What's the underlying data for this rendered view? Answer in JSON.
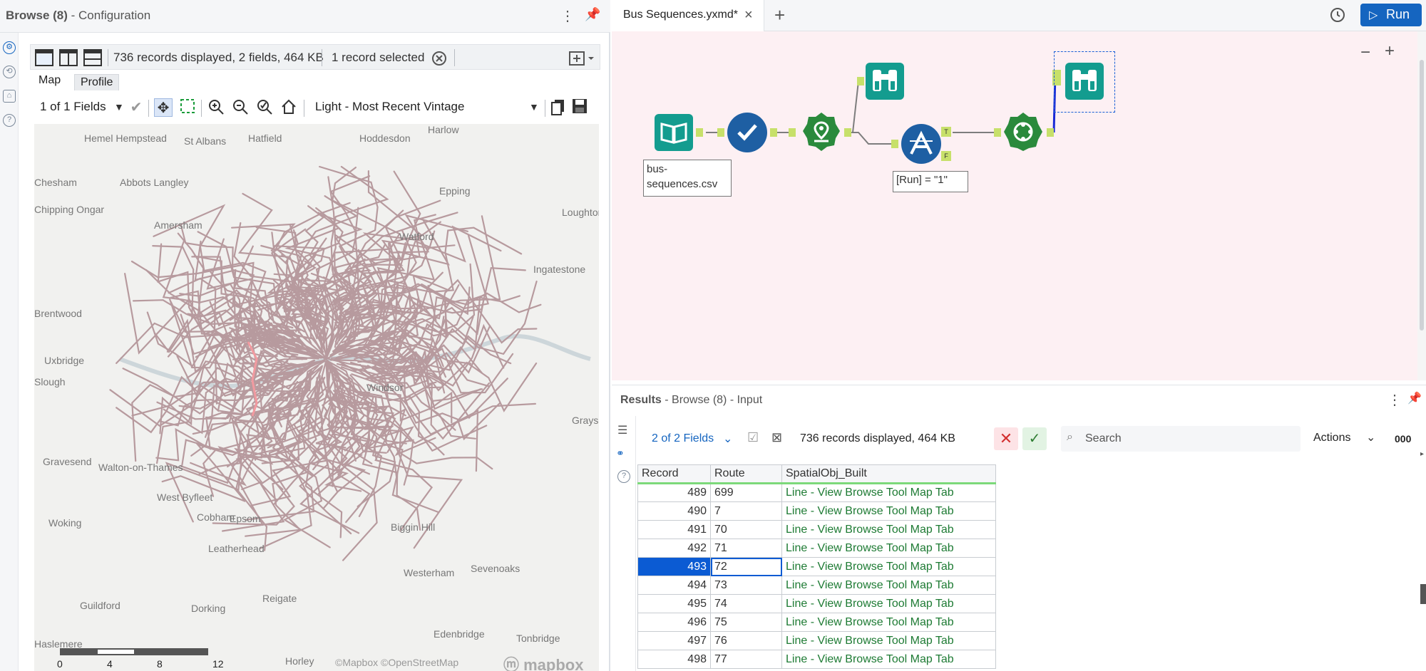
{
  "left_panel": {
    "title_prefix": "Browse (8)",
    "title_suffix": " - Configuration",
    "toolbar": {
      "records_info": "736 records displayed, 2 fields, 464 KB",
      "selected_info": "1 record selected"
    },
    "tabs": {
      "map": "Map",
      "profile": "Profile"
    },
    "fields_select": "1 of 1 Fields",
    "basemap_select": "Light - Most Recent Vintage",
    "map": {
      "places": [
        "Hemel Hempstead",
        "St Albans",
        "Hatfield",
        "Hoddesdon",
        "Harlow",
        "Chesham",
        "Abbots Langley",
        "Epping",
        "Chipping Ongar",
        "Amersham",
        "Watford",
        "Loughton",
        "Ingatestone",
        "Brentwood",
        "Uxbridge",
        "Slough",
        "Windsor",
        "Grays",
        "Gravesend",
        "Walton-on-Thames",
        "West Byfleet",
        "Cobham",
        "Woking",
        "Leatherhead",
        "Epsom",
        "Biggin Hill",
        "Westerham",
        "Sevenoaks",
        "Guildford",
        "Dorking",
        "Reigate",
        "Edenbridge",
        "Tonbridge",
        "Haslemere",
        "Horley"
      ],
      "scale_labels": [
        "0",
        "4",
        "8",
        "12 mi"
      ],
      "attribution": "©Mapbox ©OpenStreetMap",
      "logo_text": "mapbox"
    }
  },
  "workflow_tab": {
    "title": "Bus Sequences.yxmd*",
    "run_label": "Run"
  },
  "canvas": {
    "input_label": "bus-\nsequences.csv",
    "filter_label": "[Run] = \"1\"",
    "anchor_t": "T",
    "anchor_f": "F"
  },
  "results": {
    "title": "Results",
    "subtitle": " - Browse (8) - Input",
    "fields_select": "2 of 2 Fields",
    "records_info": "736 records displayed, 464 KB",
    "search_placeholder": "Search",
    "actions_label": "Actions",
    "more_label": "000",
    "columns": [
      "Record",
      "Route",
      "SpatialObj_Built"
    ],
    "rows": [
      {
        "record": "489",
        "route": "699",
        "spatial": "Line - View Browse Tool Map Tab"
      },
      {
        "record": "490",
        "route": "7",
        "spatial": "Line - View Browse Tool Map Tab"
      },
      {
        "record": "491",
        "route": "70",
        "spatial": "Line - View Browse Tool Map Tab"
      },
      {
        "record": "492",
        "route": "71",
        "spatial": "Line - View Browse Tool Map Tab"
      },
      {
        "record": "493",
        "route": "72",
        "spatial": "Line - View Browse Tool Map Tab"
      },
      {
        "record": "494",
        "route": "73",
        "spatial": "Line - View Browse Tool Map Tab"
      },
      {
        "record": "495",
        "route": "74",
        "spatial": "Line - View Browse Tool Map Tab"
      },
      {
        "record": "496",
        "route": "75",
        "spatial": "Line - View Browse Tool Map Tab"
      },
      {
        "record": "497",
        "route": "76",
        "spatial": "Line - View Browse Tool Map Tab"
      },
      {
        "record": "498",
        "route": "77",
        "spatial": "Line - View Browse Tool Map Tab"
      }
    ],
    "selected_record": "493"
  },
  "colors": {
    "accent": "#1565c0",
    "canvas_bg": "#fdf0f3",
    "browse_tool": "#139c8f",
    "select_tool": "#1e5fa3",
    "spatial_tool": "#2a8a3c",
    "route_lines": "#b79a9e"
  }
}
